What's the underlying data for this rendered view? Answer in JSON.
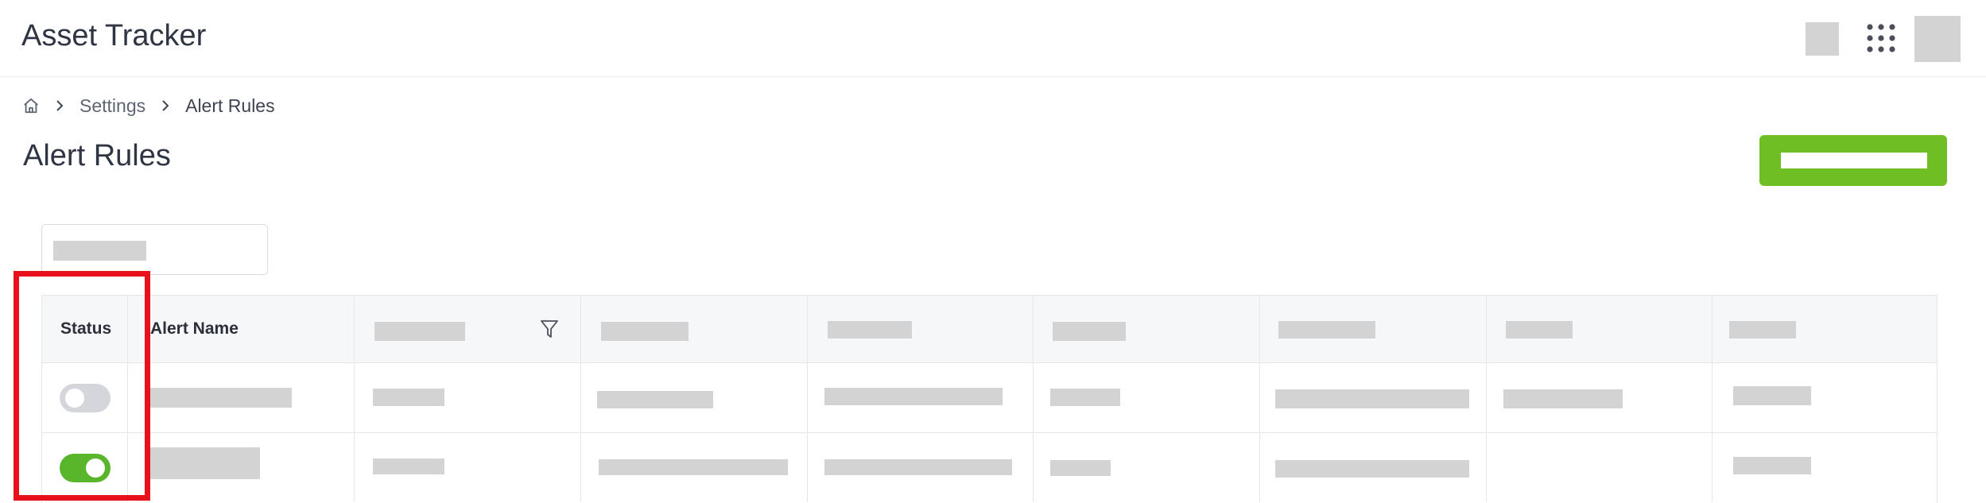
{
  "header": {
    "app_title": "Asset Tracker",
    "icons": {
      "apps": "apps-grid-icon"
    }
  },
  "breadcrumb": {
    "home_icon": "home-icon",
    "separator_icon": "chevron-right-icon",
    "items": [
      "Settings",
      "Alert Rules"
    ]
  },
  "page": {
    "title": "Alert Rules",
    "accent_color": "#6fbf24"
  },
  "table": {
    "columns": [
      "Status",
      "Alert Name"
    ],
    "filter_icon": "filter-icon",
    "rows": [
      {
        "status_enabled": false
      },
      {
        "status_enabled": true
      }
    ]
  },
  "annotation": {
    "color": "#e8111b"
  }
}
